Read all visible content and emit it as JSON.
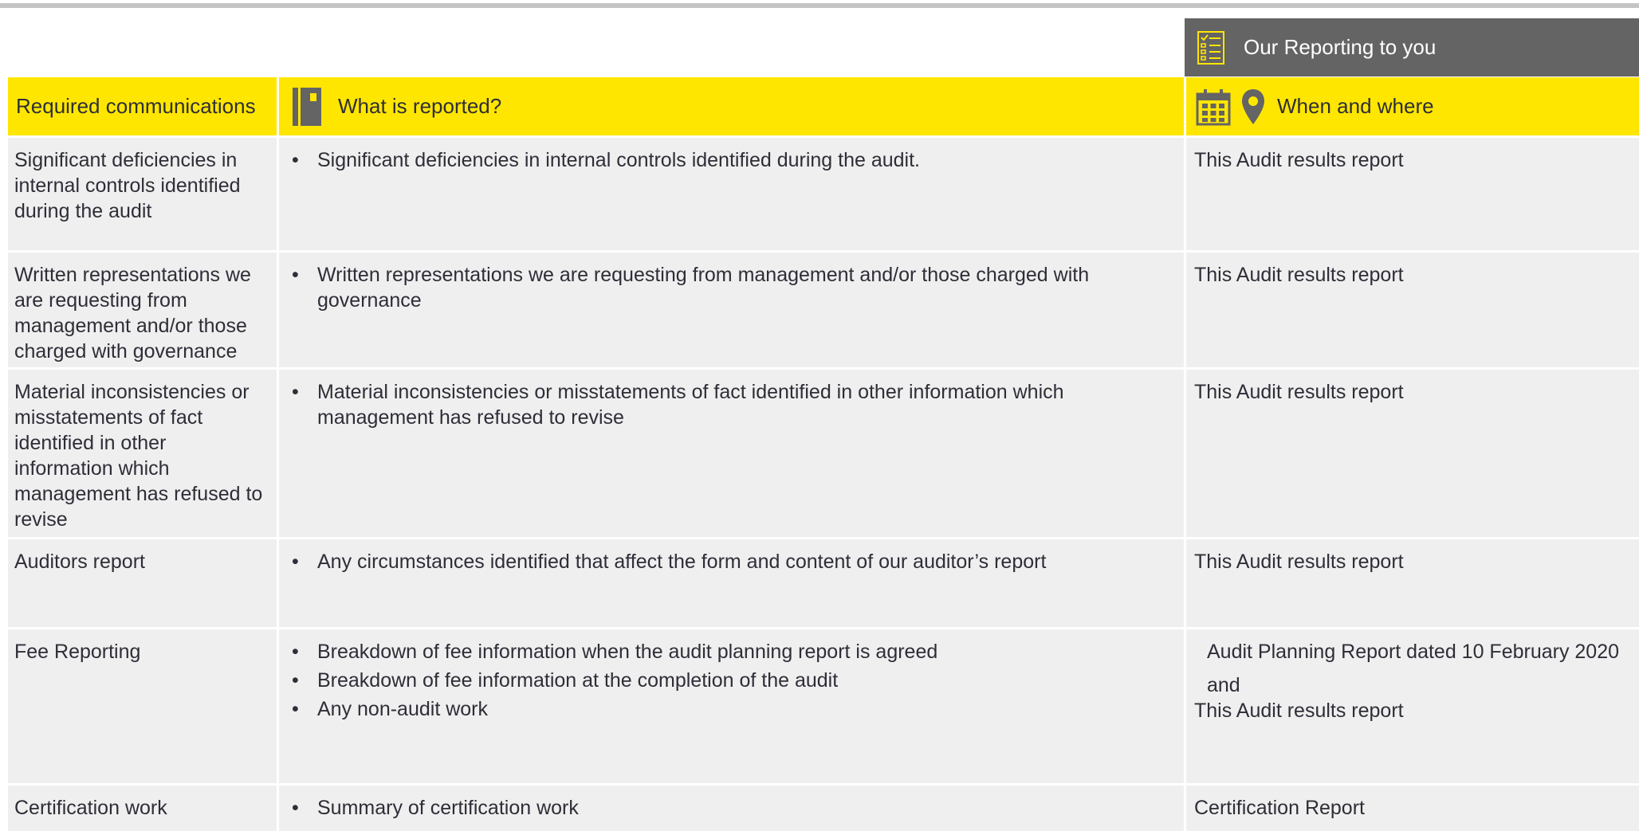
{
  "reporting_tab": {
    "label": "Our Reporting to you"
  },
  "header": {
    "col1": "Required communications",
    "col2": "What is reported?",
    "col3": "When and where"
  },
  "rows": [
    {
      "communication": "Significant deficiencies in internal controls identified during the audit",
      "reported": [
        "Significant deficiencies in internal controls identified during the audit."
      ],
      "where": "This Audit results report"
    },
    {
      "communication": "Written representations we are requesting from management and/or those charged with governance",
      "reported": [
        "Written representations we are requesting from management and/or those charged with governance"
      ],
      "where": "This Audit results report"
    },
    {
      "communication": "Material inconsistencies or misstatements of fact identified in other information which management has refused to revise",
      "reported": [
        "Material inconsistencies or misstatements of fact identified in other information which management has refused to revise"
      ],
      "where": "This Audit results report"
    },
    {
      "communication": "Auditors report",
      "reported": [
        "Any circumstances identified that affect the form and content of our auditor’s report"
      ],
      "where": "This Audit results report"
    },
    {
      "communication": "Fee Reporting",
      "reported": [
        "Breakdown of fee information when the  audit planning report is agreed",
        "Breakdown of fee information at the completion of the audit",
        "Any non-audit work"
      ],
      "where_lines": [
        "Audit Planning Report dated 10 February 2020",
        "and",
        "This Audit results report"
      ]
    },
    {
      "communication": "Certification work",
      "reported": [
        "Summary of certification work"
      ],
      "where": "Certification Report"
    }
  ],
  "colors": {
    "accent": "#ffe600",
    "tab_bg": "#646464",
    "row_bg": "#efefef",
    "text": "#2e2e38"
  },
  "icons": [
    "checklist-icon",
    "notebook-icon",
    "calendar-icon",
    "location-pin-icon"
  ]
}
